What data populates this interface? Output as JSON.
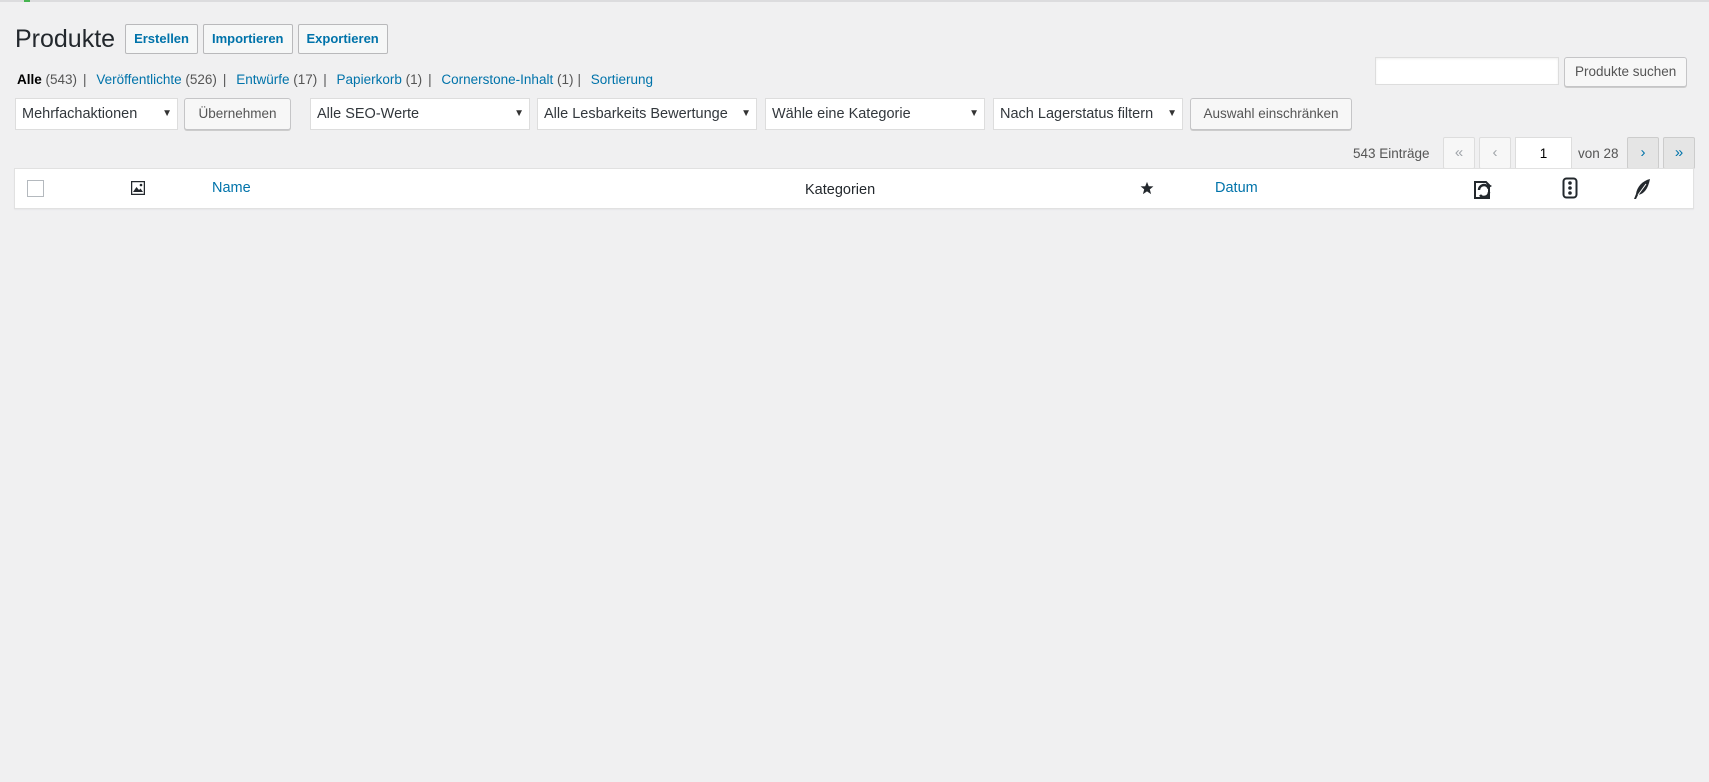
{
  "page": {
    "title": "Produkte",
    "actions": [
      "Erstellen",
      "Importieren",
      "Exportieren"
    ]
  },
  "filters": {
    "all_label": "Alle",
    "all_count": "(543)",
    "published_label": "Veröffentlichte",
    "published_count": "(526)",
    "drafts_label": "Entwürfe",
    "drafts_count": "(17)",
    "trash_label": "Papierkorb",
    "trash_count": "(1)",
    "cornerstone_label": "Cornerstone-Inhalt",
    "cornerstone_count": "(1)",
    "sorting_label": "Sortierung"
  },
  "search": {
    "value": "",
    "button_label": "Produkte suchen"
  },
  "tablenav": {
    "bulk_select": "Mehrfachaktionen",
    "apply_label": "Übernehmen",
    "seo_select": "Alle SEO-Werte",
    "readability_select": "Alle Lesbarkeits Bewertunge",
    "category_select": "Wähle eine Kategorie",
    "stock_select": "Nach Lagerstatus filtern",
    "filter_label": "Auswahl einschränken"
  },
  "pagination": {
    "items": "543 Einträge",
    "first": "«",
    "prev": "‹",
    "current_page": "1",
    "of_label": "von 28",
    "next": "›",
    "last": "»"
  },
  "table": {
    "columns": {
      "name": "Name",
      "categories": "Kategorien",
      "date": "Datum"
    },
    "icons": [
      "image-icon",
      "star-icon",
      "seo-icon",
      "readability-icon",
      "feather-icon"
    ]
  },
  "colors": {
    "link": "#0073aa",
    "background": "#f0f0f1"
  }
}
